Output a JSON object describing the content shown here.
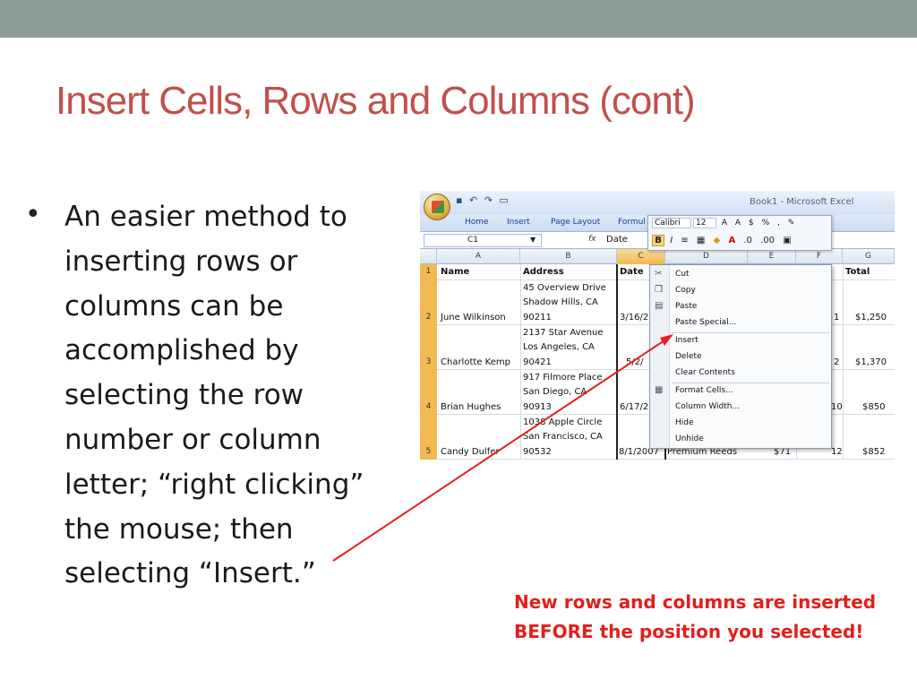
{
  "slide": {
    "title": "Insert Cells, Rows and Columns (cont)",
    "bullet_marker": "•",
    "bullet_lines": [
      "An easier method to",
      "inserting rows or",
      "columns can be",
      "accomplished by",
      "selecting the row",
      "number or column",
      "letter; “right clicking”",
      "the mouse; then",
      "selecting “Insert.”"
    ],
    "note_lines": [
      "New rows and columns are inserted",
      "BEFORE the position you selected!"
    ],
    "colors": {
      "title": "#c0504d",
      "note": "#e0201b",
      "arrow": "#e02020",
      "topbar": "#8e9c95"
    }
  },
  "excel": {
    "window_title": "Book1 - Microsoft Excel",
    "quick_access": [
      "save-icon",
      "undo-icon",
      "redo-icon",
      "open-icon"
    ],
    "tabs": [
      "Home",
      "Insert",
      "Page Layout",
      "Formul"
    ],
    "name_box": "C1",
    "fx_label": "fx",
    "formula_value": "Date",
    "mini_toolbar": {
      "font": "Calibri",
      "size": "12",
      "row1_symbols": [
        "A",
        "A",
        "$",
        "%",
        ","
      ],
      "row2_symbols": [
        "B",
        "I",
        "≡",
        "▦",
        "A",
        ".0",
        ".00"
      ]
    },
    "column_headers": [
      "A",
      "B",
      "C",
      "D",
      "E",
      "F",
      "G"
    ],
    "row_headers": [
      "1",
      "2",
      "3",
      "4",
      "5"
    ],
    "header_row": {
      "name": "Name",
      "address": "Address",
      "date": "Date",
      "total": "Total"
    },
    "rows": [
      {
        "name": "June Wilkinson",
        "address": [
          "45 Overview Drive",
          "Shadow Hills, CA",
          "90211"
        ],
        "date": "3/16/2",
        "f": "1",
        "total": "$1,250"
      },
      {
        "name": "Charlotte Kemp",
        "address": [
          "2137 Star Avenue",
          "Los Angeles, CA",
          "90421"
        ],
        "date": "5/2/",
        "f": "2",
        "total": "$1,370"
      },
      {
        "name": "Brian Hughes",
        "address": [
          "917 Filmore Place",
          "San Diego, CA",
          "90913"
        ],
        "date": "6/17/2",
        "f": "10",
        "total": "$850"
      },
      {
        "name": "Candy Dulfer",
        "address": [
          "1038 Apple Circle",
          "San Francisco, CA",
          "90532"
        ],
        "date": "8/1/2007",
        "product": "Premium Reeds",
        "price": "$71",
        "f": "12",
        "total": "$852"
      }
    ],
    "context_menu": [
      {
        "label": "Cut",
        "icon": "scissors-icon"
      },
      {
        "label": "Copy",
        "icon": "copy-icon"
      },
      {
        "label": "Paste",
        "icon": "paste-icon"
      },
      {
        "label": "Paste Special...",
        "icon": ""
      },
      {
        "label": "Insert",
        "icon": ""
      },
      {
        "label": "Delete",
        "icon": ""
      },
      {
        "label": "Clear Contents",
        "icon": ""
      },
      {
        "label": "Format Cells...",
        "icon": "format-cells-icon"
      },
      {
        "label": "Column Width...",
        "icon": ""
      },
      {
        "label": "Hide",
        "icon": ""
      },
      {
        "label": "Unhide",
        "icon": ""
      }
    ]
  }
}
